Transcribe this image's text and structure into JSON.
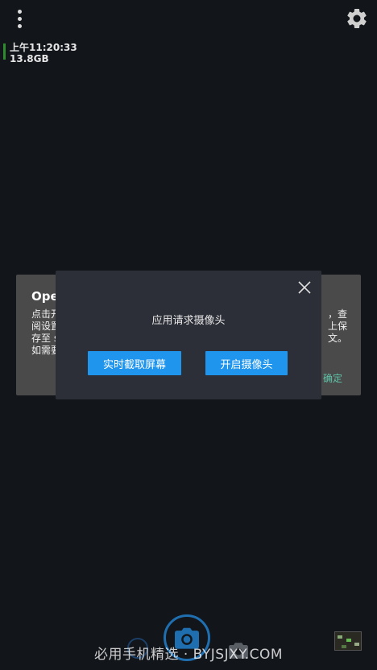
{
  "status": {
    "time": "上午11:20:33",
    "storage": "13.8GB"
  },
  "background_dialog": {
    "title": "Oper",
    "lines_left": [
      "点击开",
      "阅设置",
      "存至 s",
      "如需要"
    ],
    "lines_right": [
      "，查",
      "上保",
      "文。"
    ],
    "ok_label": "确定"
  },
  "permission_dialog": {
    "message": "应用请求摄像头",
    "screen_capture_label": "实时截取屏幕",
    "open_camera_label": "开启摄像头"
  },
  "watermark": "必用手机精选 · BYJSJXY.COM",
  "icons": [
    "more-vert-icon",
    "gear-icon",
    "close-icon",
    "camera-icon",
    "camera-switch-icon"
  ],
  "colors": {
    "background": "#12151a",
    "accent": "#1f95ee",
    "dialog": "#2d2f38",
    "ok_text": "#5fc4a8"
  }
}
